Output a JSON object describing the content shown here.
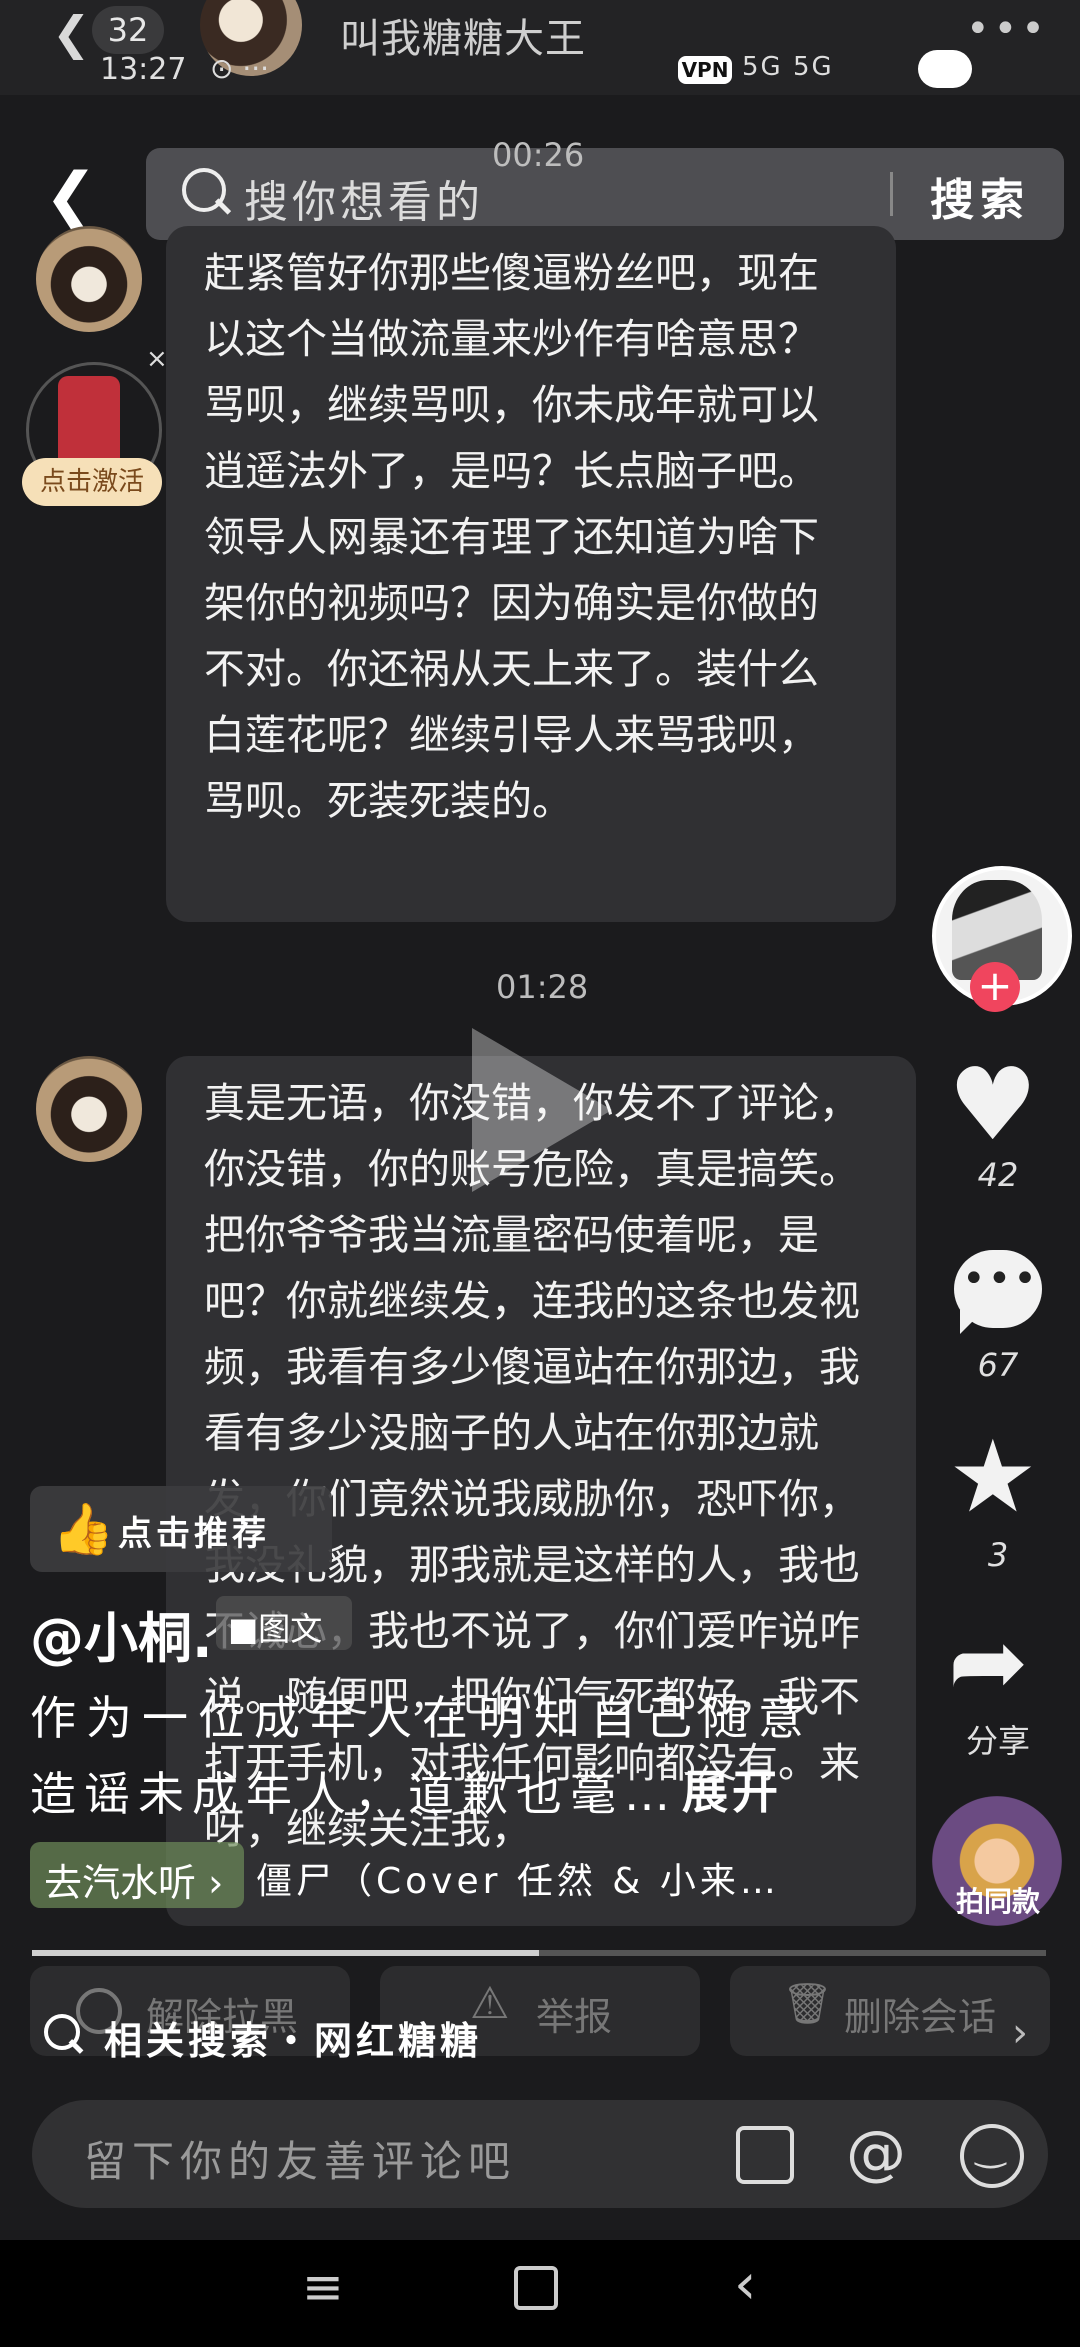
{
  "header": {
    "badge": "32",
    "time": "13:27",
    "status_dots": "⊙ ···",
    "chat_title": "叫我糖糖大王",
    "more": "•••",
    "vpn": "VPN",
    "network": "5G 5G"
  },
  "search": {
    "placeholder": "搜你想看的",
    "button": "搜索"
  },
  "timestamps": [
    "00:26",
    "01:28"
  ],
  "promo": {
    "activate": "点击激活",
    "close": "×"
  },
  "messages": [
    {
      "text": "赶紧管好你那些傻逼粉丝吧，现在以这个当做流量来炒作有啥意思？骂呗，继续骂呗，你未成年就可以逍遥法外了，是吗？长点脑子吧。领导人网暴还有理了还知道为啥下架你的视频吗？因为确实是你做的不对。你还祸从天上来了。装什么白莲花呢？继续引导人来骂我呗，骂呗。死装死装的。"
    },
    {
      "text": "真是无语，你没错，你发不了评论，你没错，你的账号危险，真是搞笑。把你爷爷我当流量密码使着呢，是吧？你就继续发，连我的这条也发视频，我看有多少傻逼站在你那边，我看有多少没脑子的人站在你那边就发，你们竟然说我威胁你，恐吓你，我没礼貌，那我就是这样的人，我也不诚心，我也不说了，你们爱咋说咋说。随便吧，把你们气死都好，我不打开手机，对我任何影响都没有。来呀，继续关注我，"
    }
  ],
  "rail": {
    "like_count": "42",
    "comment_count": "67",
    "favorite_count": "3",
    "share_label": "分享",
    "music_label": "拍同款"
  },
  "overlay": {
    "recommend": "点击推荐",
    "author": "@小桐.",
    "tuwen": "图文",
    "caption_line1": "作为一位成年人在明知自己随意",
    "caption_line2": "造谣未成年人，道歉也毫…",
    "expand": "展开",
    "audio_label": "去汽水听",
    "audio_track": "僵尸（Cover 任然 & 小来…",
    "progress": 0.5
  },
  "actions": {
    "unblock": "解除拉黑",
    "report": "举报",
    "delete": "删除会话"
  },
  "related_search": "相关搜索・网红糖糖",
  "comment_input": {
    "placeholder": "留下你的友善评论吧"
  },
  "icons": [
    "back-icon",
    "search-icon",
    "heart-icon",
    "comment-icon",
    "star-icon",
    "share-icon",
    "thumb-icon",
    "image-icon",
    "at-icon",
    "emoji-icon",
    "block-icon",
    "warning-icon",
    "trash-icon",
    "nav-menu-icon",
    "nav-home-icon",
    "nav-back-icon"
  ]
}
